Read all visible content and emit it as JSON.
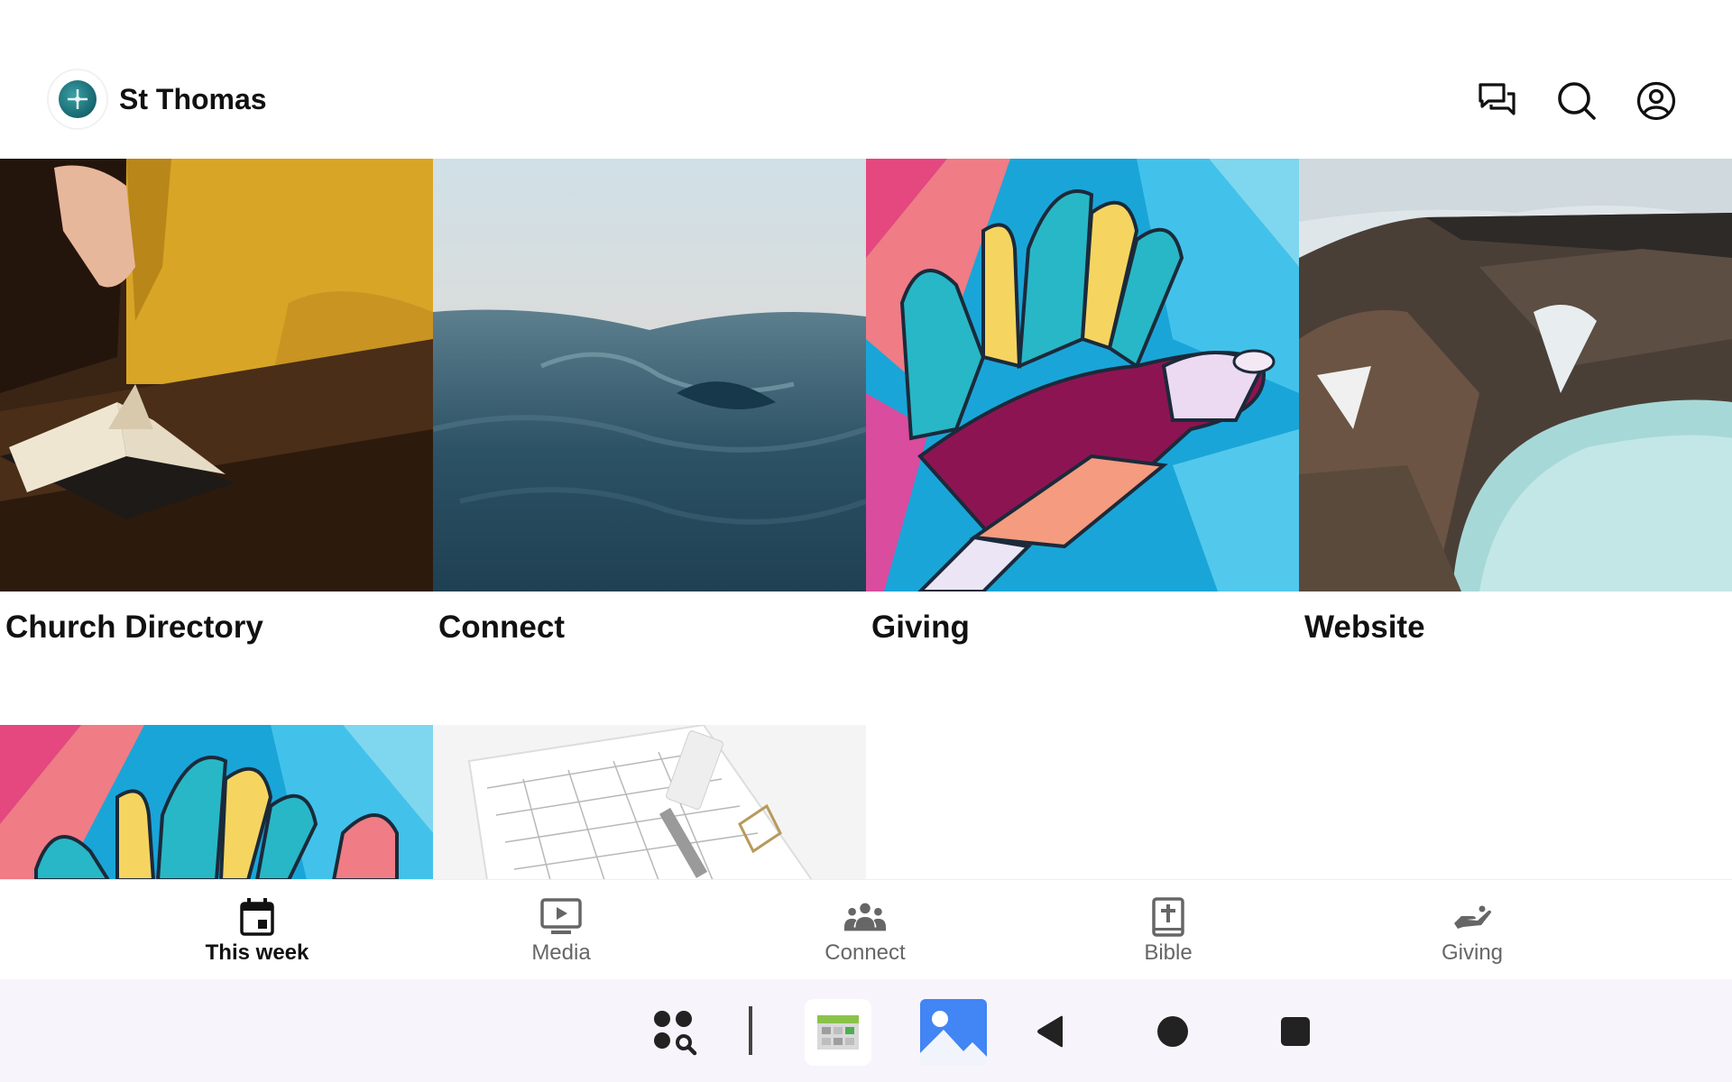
{
  "header": {
    "title": "St Thomas",
    "icons": [
      "chat-icon",
      "search-icon",
      "account-icon"
    ]
  },
  "tiles": [
    {
      "label": "Church Directory",
      "image": "person-reading-bible-photo"
    },
    {
      "label": "Connect",
      "image": "ocean-water-photo"
    },
    {
      "label": "Giving",
      "image": "colorful-hands-mural-photo"
    },
    {
      "label": "Website",
      "image": "crater-lake-landscape-photo"
    },
    {
      "label": "",
      "image": "colorful-hands-mural-photo"
    },
    {
      "label": "",
      "image": "calendar-planner-photo"
    }
  ],
  "bottom_nav": {
    "items": [
      {
        "label": "This week",
        "icon": "calendar-icon",
        "active": true
      },
      {
        "label": "Media",
        "icon": "video-icon",
        "active": false
      },
      {
        "label": "Connect",
        "icon": "group-icon",
        "active": false
      },
      {
        "label": "Bible",
        "icon": "bible-icon",
        "active": false
      },
      {
        "label": "Giving",
        "icon": "hand-giving-icon",
        "active": false
      }
    ]
  },
  "system_bar": {
    "icons": [
      "app-search-icon",
      "calendar-app-icon",
      "gallery-app-icon",
      "back-icon",
      "home-icon",
      "recents-icon"
    ]
  },
  "colors": {
    "text_primary": "#111111",
    "text_secondary": "#666666",
    "system_bar_bg": "#f7f5fb",
    "logo_teal": "#17656e"
  }
}
